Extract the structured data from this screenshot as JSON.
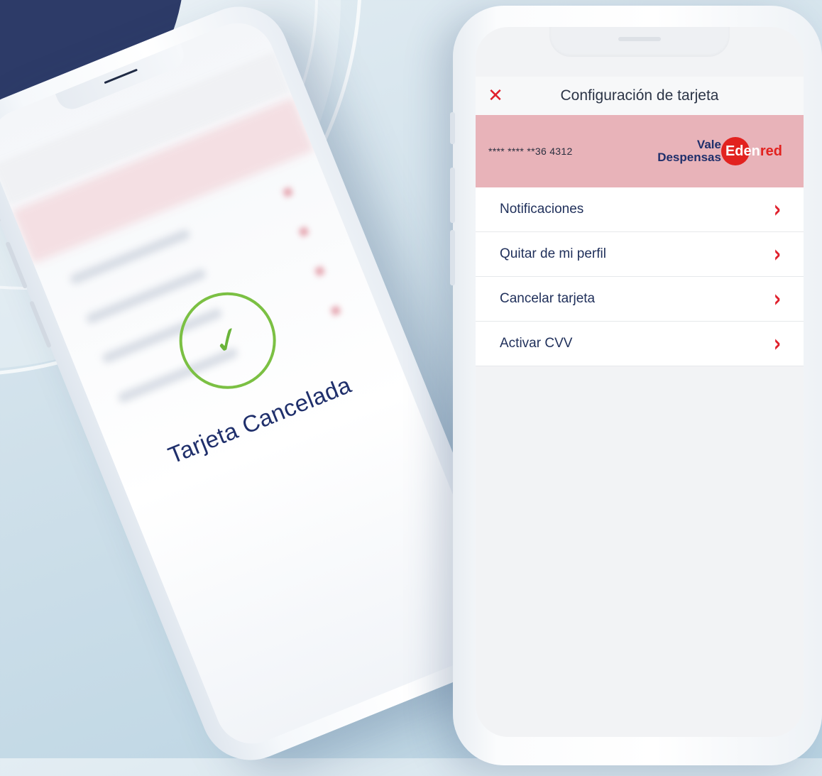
{
  "left_phone": {
    "status_message": "Tarjeta Cancelada",
    "check_glyph": "✓"
  },
  "app": {
    "close_glyph": "✕",
    "title": "Configuración de tarjeta",
    "card": {
      "number_masked": "**** **** **36 4312",
      "brand_line1": "Vale",
      "brand_line2": "Despensas",
      "edenred_inside": "Eden",
      "edenred_outside": "red"
    },
    "menu": [
      {
        "label": "Notificaciones",
        "icon": "chevron-right-icon"
      },
      {
        "label": "Quitar de mi perfil",
        "icon": "chevron-right-icon"
      },
      {
        "label": "Cancelar tarjeta",
        "icon": "chevron-right-icon"
      },
      {
        "label": "Activar CVV",
        "icon": "chevron-right-icon"
      }
    ],
    "chevron_glyph": "›"
  },
  "colors": {
    "accent_red": "#e0202c",
    "navy": "#1f2f6b",
    "success_green": "#7bc043",
    "card_bg": "#e8b3b9"
  }
}
